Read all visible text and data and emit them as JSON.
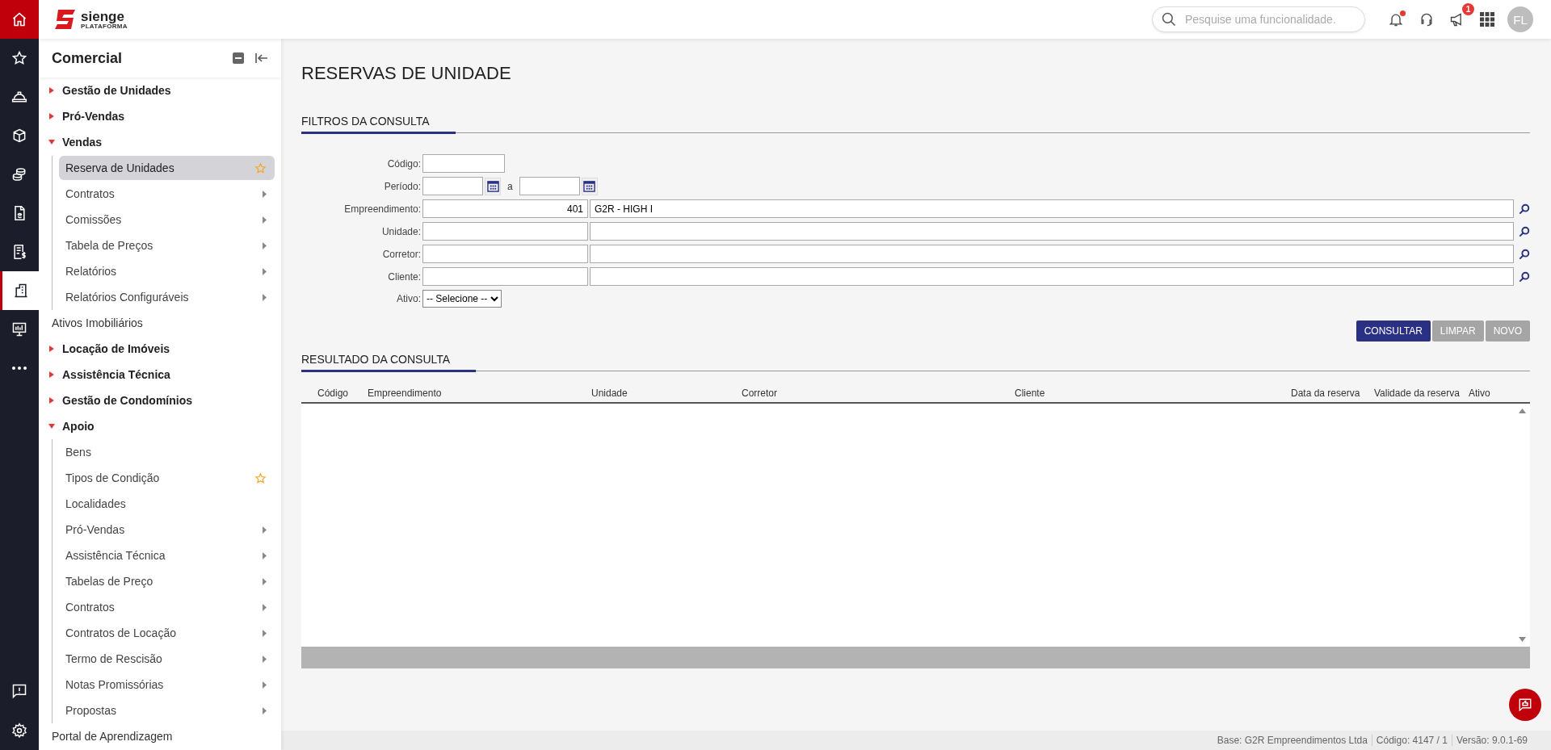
{
  "rail": {
    "items": [
      {
        "kind": "home",
        "selected": false
      },
      {
        "kind": "favorites",
        "selected": false
      },
      {
        "kind": "engineering",
        "selected": false
      },
      {
        "kind": "supplies",
        "selected": false
      },
      {
        "kind": "finance",
        "selected": false
      },
      {
        "kind": "documents",
        "selected": false
      },
      {
        "kind": "billing",
        "selected": false
      },
      {
        "kind": "commercial",
        "selected": true
      },
      {
        "kind": "reports",
        "selected": false
      },
      {
        "kind": "more",
        "selected": false
      }
    ],
    "bottom_items": [
      {
        "kind": "feedback"
      },
      {
        "kind": "settings"
      }
    ]
  },
  "header": {
    "logo": {
      "name": "sienge",
      "tagline": "PLATAFORMA"
    },
    "search": {
      "placeholder": "Pesquise uma funcionalidade."
    },
    "notifications_unread": true,
    "announcements_badge": "1",
    "avatar": "FL"
  },
  "sidebar": {
    "title": "Comercial",
    "items": [
      {
        "kind": "group",
        "label": "Gestão de Unidades",
        "expanded": false
      },
      {
        "kind": "group",
        "label": "Pró-Vendas",
        "expanded": false
      },
      {
        "kind": "group",
        "label": "Vendas",
        "expanded": true,
        "children": [
          {
            "label": "Reserva de Unidades",
            "selected": true,
            "starred": true,
            "submenu": false
          },
          {
            "label": "Contratos",
            "selected": false,
            "starred": false,
            "submenu": true
          },
          {
            "label": "Comissões",
            "selected": false,
            "starred": false,
            "submenu": true
          },
          {
            "label": "Tabela de Preços",
            "selected": false,
            "starred": false,
            "submenu": true
          },
          {
            "label": "Relatórios",
            "selected": false,
            "starred": false,
            "submenu": true
          },
          {
            "label": "Relatórios Configuráveis",
            "selected": false,
            "starred": false,
            "submenu": true
          }
        ]
      },
      {
        "kind": "link",
        "label": "Ativos Imobiliários"
      },
      {
        "kind": "group",
        "label": "Locação de Imóveis",
        "expanded": false
      },
      {
        "kind": "group",
        "label": "Assistência Técnica",
        "expanded": false
      },
      {
        "kind": "group",
        "label": "Gestão de Condomínios",
        "expanded": false
      },
      {
        "kind": "group",
        "label": "Apoio",
        "expanded": true,
        "children": [
          {
            "label": "Bens",
            "selected": false,
            "starred": false,
            "submenu": false
          },
          {
            "label": "Tipos de Condição",
            "selected": false,
            "starred": true,
            "submenu": false
          },
          {
            "label": "Localidades",
            "selected": false,
            "starred": false,
            "submenu": false
          },
          {
            "label": "Pró-Vendas",
            "selected": false,
            "starred": false,
            "submenu": true
          },
          {
            "label": "Assistência Técnica",
            "selected": false,
            "starred": false,
            "submenu": true
          },
          {
            "label": "Tabelas de Preço",
            "selected": false,
            "starred": false,
            "submenu": true
          },
          {
            "label": "Contratos",
            "selected": false,
            "starred": false,
            "submenu": true
          },
          {
            "label": "Contratos de Locação",
            "selected": false,
            "starred": false,
            "submenu": true
          },
          {
            "label": "Termo de Rescisão",
            "selected": false,
            "starred": false,
            "submenu": true
          },
          {
            "label": "Notas Promissórias",
            "selected": false,
            "starred": false,
            "submenu": true
          },
          {
            "label": "Propostas",
            "selected": false,
            "starred": false,
            "submenu": true
          }
        ]
      },
      {
        "kind": "link",
        "label": "Portal de Aprendizagem"
      }
    ]
  },
  "page": {
    "title": "RESERVAS DE UNIDADE",
    "filters": {
      "heading": "FILTROS DA CONSULTA",
      "fields": [
        {
          "kind": "text",
          "label": "Código:"
        },
        {
          "kind": "date_range",
          "label": "Período:",
          "separator": "a"
        },
        {
          "kind": "lookup",
          "label": "Empreendimento:",
          "code": "401",
          "name": "G2R - HIGH I"
        },
        {
          "kind": "lookup",
          "label": "Unidade:"
        },
        {
          "kind": "lookup",
          "label": "Corretor:"
        },
        {
          "kind": "lookup",
          "label": "Cliente:"
        },
        {
          "kind": "select",
          "label": "Ativo:",
          "value": "-- Selecione --"
        }
      ]
    },
    "buttons": [
      {
        "label": "CONSULTAR",
        "kind": "primary"
      },
      {
        "label": "LIMPAR",
        "kind": "secondary"
      },
      {
        "label": "NOVO",
        "kind": "secondary"
      }
    ],
    "results": {
      "heading": "RESULTADO DA CONSULTA",
      "columns": [
        "Código",
        "Empreendimento",
        "Unidade",
        "Corretor",
        "Cliente",
        "Data da reserva",
        "Validade da reserva",
        "Ativo"
      ]
    }
  },
  "status_bar": [
    "Base: G2R Empreendimentos Ltda",
    "Código: 4147 / 1",
    "Versão: 9.0.1-69"
  ]
}
